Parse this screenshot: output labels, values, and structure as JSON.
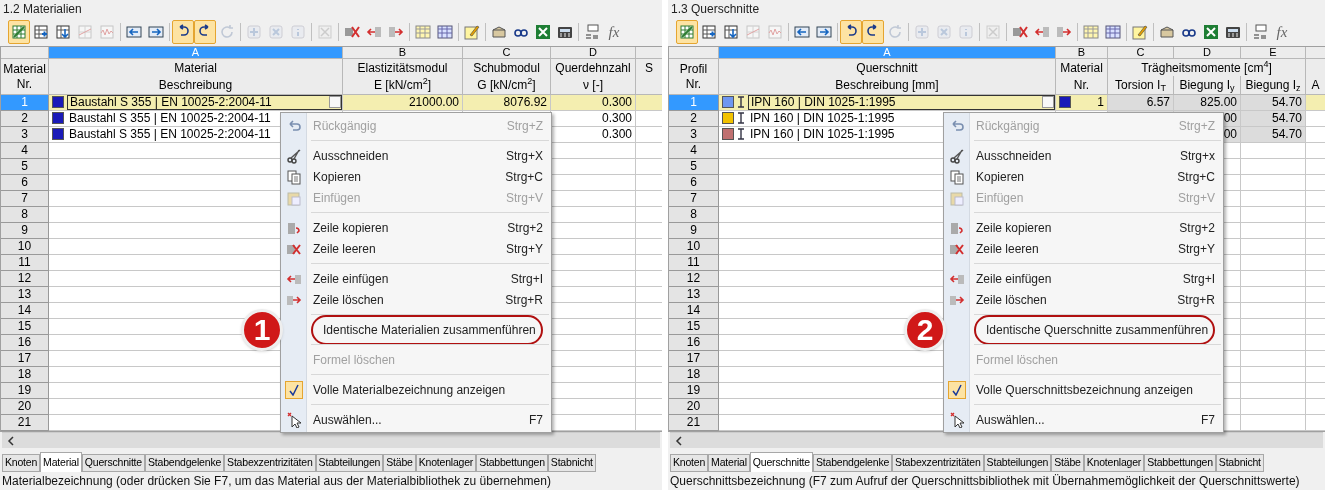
{
  "panels": [
    {
      "title": "1.2 Materialien",
      "toolbar": [
        [
          {
            "kind": "grid-check",
            "pressed": true,
            "disabled": false
          },
          {
            "kind": "grid-plus",
            "pressed": false,
            "disabled": false
          },
          {
            "kind": "grid-down",
            "pressed": false,
            "disabled": false
          },
          {
            "kind": "grid-chart",
            "pressed": false,
            "disabled": true
          },
          {
            "kind": "wave",
            "pressed": false,
            "disabled": true
          }
        ],
        [
          {
            "kind": "arrow-left",
            "pressed": false,
            "disabled": false
          },
          {
            "kind": "arrow-right",
            "pressed": false,
            "disabled": false
          }
        ],
        [
          {
            "kind": "undo",
            "pressed": true,
            "disabled": false
          },
          {
            "kind": "redo",
            "pressed": true,
            "disabled": false
          },
          {
            "kind": "refresh",
            "pressed": false,
            "disabled": true
          }
        ],
        [
          {
            "kind": "plus",
            "pressed": false,
            "disabled": true
          },
          {
            "kind": "cross",
            "pressed": false,
            "disabled": true
          },
          {
            "kind": "info",
            "pressed": false,
            "disabled": true
          }
        ],
        [
          {
            "kind": "xbox",
            "pressed": false,
            "disabled": true
          }
        ],
        [
          {
            "kind": "row-x",
            "pressed": false,
            "disabled": false
          },
          {
            "kind": "row-in",
            "pressed": false,
            "disabled": false
          },
          {
            "kind": "row-out",
            "pressed": false,
            "disabled": false
          }
        ],
        [
          {
            "kind": "table-yellow",
            "pressed": false,
            "disabled": false
          },
          {
            "kind": "table-blue",
            "pressed": false,
            "disabled": false
          }
        ],
        [
          {
            "kind": "pencil",
            "pressed": false,
            "disabled": false
          }
        ],
        [
          {
            "kind": "box",
            "pressed": false,
            "disabled": false
          },
          {
            "kind": "glasses",
            "pressed": false,
            "disabled": false
          },
          {
            "kind": "excel",
            "pressed": false,
            "disabled": false
          },
          {
            "kind": "calc",
            "pressed": false,
            "disabled": false
          }
        ],
        [
          {
            "kind": "abc",
            "pressed": false,
            "disabled": false
          },
          {
            "kind": "fx",
            "label": "fx",
            "pressed": false,
            "disabled": false
          }
        ]
      ],
      "table": {
        "rownr_header": [
          "Material",
          "Nr."
        ],
        "columns": [
          {
            "letter": "A",
            "selected": true,
            "readonly": false
          },
          {
            "letter": "B",
            "selected": false,
            "readonly": false
          },
          {
            "letter": "C",
            "selected": false,
            "readonly": false
          },
          {
            "letter": "D",
            "selected": false,
            "readonly": false
          },
          {
            "selected": false,
            "readonly": false
          }
        ],
        "header_top": [
          {
            "text": "Material"
          },
          {
            "text": "Elastizitätsmodul"
          },
          {
            "text": "Schubmodul"
          },
          {
            "text": "Querdehnzahl"
          },
          {
            "text": "S"
          }
        ],
        "header_bottom": [
          {
            "text": "Beschreibung"
          },
          {
            "text": "E [kN/cm$^{2}$]"
          },
          {
            "text": "G [kN/cm$^{2}$]"
          },
          {
            "text": "ν [-]"
          }
        ],
        "rows": [
          {
            "nr": "1",
            "selected": true,
            "cells": [
              {
                "kind": "swatch",
                "text": "Baustahl S 355 | EN 10025-2:2004-11",
                "color": "#1a1ab8"
              },
              {
                "kind": "number",
                "text": "21000.00"
              },
              {
                "kind": "number",
                "text": "8076.92"
              },
              {
                "kind": "number",
                "text": "0.300"
              }
            ]
          },
          {
            "nr": "2",
            "selected": false,
            "cells": [
              {
                "kind": "swatch",
                "text": "Baustahl S 355 | EN 10025-2:2004-11",
                "color": "#1a1ab8"
              },
              {
                "kind": "empty"
              },
              {
                "kind": "empty"
              },
              {
                "kind": "number",
                "text": "0.300"
              }
            ]
          },
          {
            "nr": "3",
            "selected": false,
            "cells": [
              {
                "kind": "swatch",
                "text": "Baustahl S 355 | EN 10025-2:2004-11",
                "color": "#1a1ab8"
              },
              {
                "kind": "empty"
              },
              {
                "kind": "empty"
              },
              {
                "kind": "number",
                "text": "0.300"
              }
            ]
          },
          {
            "nr": "4",
            "selected": false
          },
          {
            "nr": "5",
            "selected": false
          },
          {
            "nr": "6",
            "selected": false
          },
          {
            "nr": "7",
            "selected": false
          },
          {
            "nr": "8",
            "selected": false
          },
          {
            "nr": "9",
            "selected": false
          },
          {
            "nr": "10",
            "selected": false
          },
          {
            "nr": "11",
            "selected": false
          },
          {
            "nr": "12",
            "selected": false
          },
          {
            "nr": "13",
            "selected": false
          },
          {
            "nr": "14",
            "selected": false
          },
          {
            "nr": "15",
            "selected": false
          },
          {
            "nr": "16",
            "selected": false
          },
          {
            "nr": "17",
            "selected": false
          },
          {
            "nr": "18",
            "selected": false
          },
          {
            "nr": "19",
            "selected": false
          },
          {
            "nr": "20",
            "selected": false
          },
          {
            "nr": "21",
            "selected": false
          }
        ]
      },
      "context_menu": [
        {
          "kind": "item",
          "label": "Rückgängig",
          "shortcut": "Strg+Z",
          "disabled": true,
          "checked": false,
          "highlighted": false
        },
        {
          "kind": "separator"
        },
        {
          "kind": "item",
          "label": "Ausschneiden",
          "shortcut": "Strg+X",
          "disabled": false,
          "checked": false,
          "highlighted": false
        },
        {
          "kind": "item",
          "label": "Kopieren",
          "shortcut": "Strg+C",
          "disabled": false,
          "checked": false,
          "highlighted": false
        },
        {
          "kind": "item",
          "label": "Einfügen",
          "shortcut": "Strg+V",
          "disabled": true,
          "checked": false,
          "highlighted": false
        },
        {
          "kind": "separator"
        },
        {
          "kind": "item",
          "label": "Zeile kopieren",
          "shortcut": "Strg+2",
          "disabled": false,
          "checked": false,
          "highlighted": false
        },
        {
          "kind": "item",
          "label": "Zeile leeren",
          "shortcut": "Strg+Y",
          "disabled": false,
          "checked": false,
          "highlighted": false
        },
        {
          "kind": "separator"
        },
        {
          "kind": "item",
          "label": "Zeile einfügen",
          "shortcut": "Strg+I",
          "disabled": false,
          "checked": false,
          "highlighted": false
        },
        {
          "kind": "item",
          "label": "Zeile löschen",
          "shortcut": "Strg+R",
          "disabled": false,
          "checked": false,
          "highlighted": false
        },
        {
          "kind": "separator"
        },
        {
          "kind": "item",
          "label": "Identische Materialien zusammenführen",
          "disabled": false,
          "checked": false,
          "highlighted": true,
          "callout": "1"
        },
        {
          "kind": "separator"
        },
        {
          "kind": "item",
          "label": "Formel löschen",
          "disabled": true,
          "checked": false,
          "highlighted": false
        },
        {
          "kind": "separator"
        },
        {
          "kind": "item",
          "label": "Volle Materialbezeichnung anzeigen",
          "disabled": false,
          "checked": true,
          "highlighted": false
        },
        {
          "kind": "separator"
        },
        {
          "kind": "item",
          "label": "Auswählen...",
          "shortcut": "F7",
          "disabled": false,
          "checked": false,
          "highlighted": false
        }
      ],
      "tabs": [
        {
          "label": "Knoten",
          "selected": false
        },
        {
          "label": "Material",
          "selected": true
        },
        {
          "label": "Querschnitte",
          "selected": false
        },
        {
          "label": "Stabendgelenke",
          "selected": false
        },
        {
          "label": "Stabexzentrizitäten",
          "selected": false
        },
        {
          "label": "Stabteilungen",
          "selected": false
        },
        {
          "label": "Stäbe",
          "selected": false
        },
        {
          "label": "Knotenlager",
          "selected": false
        },
        {
          "label": "Stabbettungen",
          "selected": false
        },
        {
          "label": "Stabnicht",
          "selected": false
        }
      ],
      "status_bar": "Materialbezeichnung (oder drücken Sie F7, um das Material aus der Materialbibliothek zu übernehmen)"
    },
    {
      "title": "1.3 Querschnitte",
      "toolbar": [
        [
          {
            "kind": "grid-check",
            "pressed": true,
            "disabled": false
          },
          {
            "kind": "grid-plus",
            "pressed": false,
            "disabled": false
          },
          {
            "kind": "grid-down",
            "pressed": false,
            "disabled": false
          },
          {
            "kind": "grid-chart",
            "pressed": false,
            "disabled": true
          },
          {
            "kind": "wave",
            "pressed": false,
            "disabled": true
          }
        ],
        [
          {
            "kind": "arrow-left",
            "pressed": false,
            "disabled": false
          },
          {
            "kind": "arrow-right",
            "pressed": false,
            "disabled": false
          }
        ],
        [
          {
            "kind": "undo",
            "pressed": true,
            "disabled": false
          },
          {
            "kind": "redo",
            "pressed": true,
            "disabled": false
          },
          {
            "kind": "refresh",
            "pressed": false,
            "disabled": true
          }
        ],
        [
          {
            "kind": "plus",
            "pressed": false,
            "disabled": true
          },
          {
            "kind": "cross",
            "pressed": false,
            "disabled": true
          },
          {
            "kind": "info",
            "pressed": false,
            "disabled": true
          }
        ],
        [
          {
            "kind": "xbox",
            "pressed": false,
            "disabled": true
          }
        ],
        [
          {
            "kind": "row-x",
            "pressed": false,
            "disabled": false
          },
          {
            "kind": "row-in",
            "pressed": false,
            "disabled": false
          },
          {
            "kind": "row-out",
            "pressed": false,
            "disabled": false
          }
        ],
        [
          {
            "kind": "table-yellow",
            "pressed": false,
            "disabled": false
          },
          {
            "kind": "table-blue",
            "pressed": false,
            "disabled": false
          }
        ],
        [
          {
            "kind": "pencil",
            "pressed": false,
            "disabled": false
          }
        ],
        [
          {
            "kind": "box",
            "pressed": false,
            "disabled": false
          },
          {
            "kind": "glasses",
            "pressed": false,
            "disabled": false
          },
          {
            "kind": "excel",
            "pressed": false,
            "disabled": false
          },
          {
            "kind": "calc",
            "pressed": false,
            "disabled": false
          }
        ],
        [
          {
            "kind": "abc",
            "pressed": false,
            "disabled": false
          },
          {
            "kind": "fx",
            "label": "fx",
            "pressed": false,
            "disabled": false
          }
        ]
      ],
      "table": {
        "rownr_header": [
          "Profil",
          "Nr."
        ],
        "columns": [
          {
            "letter": "A",
            "selected": true,
            "readonly": false
          },
          {
            "letter": "B",
            "selected": false,
            "readonly": false
          },
          {
            "letter": "C",
            "selected": false,
            "readonly": true
          },
          {
            "letter": "D",
            "selected": false,
            "readonly": true
          },
          {
            "letter": "E",
            "selected": false,
            "readonly": true
          },
          {
            "selected": false,
            "readonly": false
          }
        ],
        "header_top": [
          {
            "text": "Querschnitt"
          },
          {
            "text": "Material"
          },
          {
            "text": "Trägheitsmomente [cm$^{4}$]"
          }
        ],
        "header_bottom": [
          {
            "text": "Beschreibung [mm]"
          },
          {
            "text": "Nr."
          },
          {
            "text": "Torsion I$_{T}$"
          },
          {
            "text": "Biegung I$_{y}$"
          },
          {
            "text": "Biegung I$_{z}$"
          },
          {
            "text": "A"
          }
        ],
        "rows": [
          {
            "nr": "1",
            "selected": true,
            "cells": [
              {
                "kind": "section",
                "text": "IPN 160 | DIN 1025-1:1995",
                "color": "#6f97f0"
              },
              {
                "kind": "ref",
                "text": "1",
                "color": "#1a1ab8"
              },
              {
                "kind": "number",
                "text": "6.57"
              },
              {
                "kind": "number",
                "text": "825.00"
              },
              {
                "kind": "number",
                "text": "54.70"
              }
            ]
          },
          {
            "nr": "2",
            "selected": false,
            "cells": [
              {
                "kind": "section",
                "text": "IPN 160 | DIN 1025-1:1995",
                "color": "#f2c200"
              },
              {
                "kind": "empty"
              },
              {
                "kind": "empty"
              },
              {
                "kind": "number",
                "text": "00"
              },
              {
                "kind": "number",
                "text": "54.70"
              }
            ]
          },
          {
            "nr": "3",
            "selected": false,
            "cells": [
              {
                "kind": "section",
                "text": "IPN 160 | DIN 1025-1:1995",
                "color": "#c07070"
              },
              {
                "kind": "empty"
              },
              {
                "kind": "empty"
              },
              {
                "kind": "number",
                "text": "00"
              },
              {
                "kind": "number",
                "text": "54.70"
              }
            ]
          },
          {
            "nr": "4",
            "selected": false
          },
          {
            "nr": "5",
            "selected": false
          },
          {
            "nr": "6",
            "selected": false
          },
          {
            "nr": "7",
            "selected": false
          },
          {
            "nr": "8",
            "selected": false
          },
          {
            "nr": "9",
            "selected": false
          },
          {
            "nr": "10",
            "selected": false
          },
          {
            "nr": "11",
            "selected": false
          },
          {
            "nr": "12",
            "selected": false
          },
          {
            "nr": "13",
            "selected": false
          },
          {
            "nr": "14",
            "selected": false
          },
          {
            "nr": "15",
            "selected": false
          },
          {
            "nr": "16",
            "selected": false
          },
          {
            "nr": "17",
            "selected": false
          },
          {
            "nr": "18",
            "selected": false
          },
          {
            "nr": "19",
            "selected": false
          },
          {
            "nr": "20",
            "selected": false
          },
          {
            "nr": "21",
            "selected": false
          }
        ]
      },
      "context_menu": [
        {
          "kind": "item",
          "label": "Rückgängig",
          "shortcut": "Strg+Z",
          "disabled": true,
          "checked": false,
          "highlighted": false
        },
        {
          "kind": "separator"
        },
        {
          "kind": "item",
          "label": "Ausschneiden",
          "shortcut": "Strg+x",
          "disabled": false,
          "checked": false,
          "highlighted": false
        },
        {
          "kind": "item",
          "label": "Kopieren",
          "shortcut": "Strg+C",
          "disabled": false,
          "checked": false,
          "highlighted": false
        },
        {
          "kind": "item",
          "label": "Einfügen",
          "shortcut": "Strg+V",
          "disabled": true,
          "checked": false,
          "highlighted": false
        },
        {
          "kind": "separator"
        },
        {
          "kind": "item",
          "label": "Zeile kopieren",
          "shortcut": "Strg+2",
          "disabled": false,
          "checked": false,
          "highlighted": false
        },
        {
          "kind": "item",
          "label": "Zeile leeren",
          "shortcut": "Strg+Y",
          "disabled": false,
          "checked": false,
          "highlighted": false
        },
        {
          "kind": "separator"
        },
        {
          "kind": "item",
          "label": "Zeile einfügen",
          "shortcut": "Strg+I",
          "disabled": false,
          "checked": false,
          "highlighted": false
        },
        {
          "kind": "item",
          "label": "Zeile löschen",
          "shortcut": "Strg+R",
          "disabled": false,
          "checked": false,
          "highlighted": false
        },
        {
          "kind": "separator"
        },
        {
          "kind": "item",
          "label": "Identische Querschnitte zusammenführen",
          "disabled": false,
          "checked": false,
          "highlighted": true,
          "callout": "2"
        },
        {
          "kind": "separator"
        },
        {
          "kind": "item",
          "label": "Formel löschen",
          "disabled": true,
          "checked": false,
          "highlighted": false
        },
        {
          "kind": "separator"
        },
        {
          "kind": "item",
          "label": "Volle Querschnittsbezeichnung anzeigen",
          "disabled": false,
          "checked": true,
          "highlighted": false
        },
        {
          "kind": "separator"
        },
        {
          "kind": "item",
          "label": "Auswählen...",
          "shortcut": "F7",
          "disabled": false,
          "checked": false,
          "highlighted": false
        }
      ],
      "tabs": [
        {
          "label": "Knoten",
          "selected": false
        },
        {
          "label": "Material",
          "selected": false
        },
        {
          "label": "Querschnitte",
          "selected": true
        },
        {
          "label": "Stabendgelenke",
          "selected": false
        },
        {
          "label": "Stabexzentrizitäten",
          "selected": false
        },
        {
          "label": "Stabteilungen",
          "selected": false
        },
        {
          "label": "Stäbe",
          "selected": false
        },
        {
          "label": "Knotenlager",
          "selected": false
        },
        {
          "label": "Stabbettungen",
          "selected": false
        },
        {
          "label": "Stabnicht",
          "selected": false
        }
      ],
      "status_bar": "Querschnittsbezeichnung (F7 zum Aufruf der Querschnittsbibliothek mit Übernahmemöglichkeit der Querschnittswerte)"
    }
  ]
}
